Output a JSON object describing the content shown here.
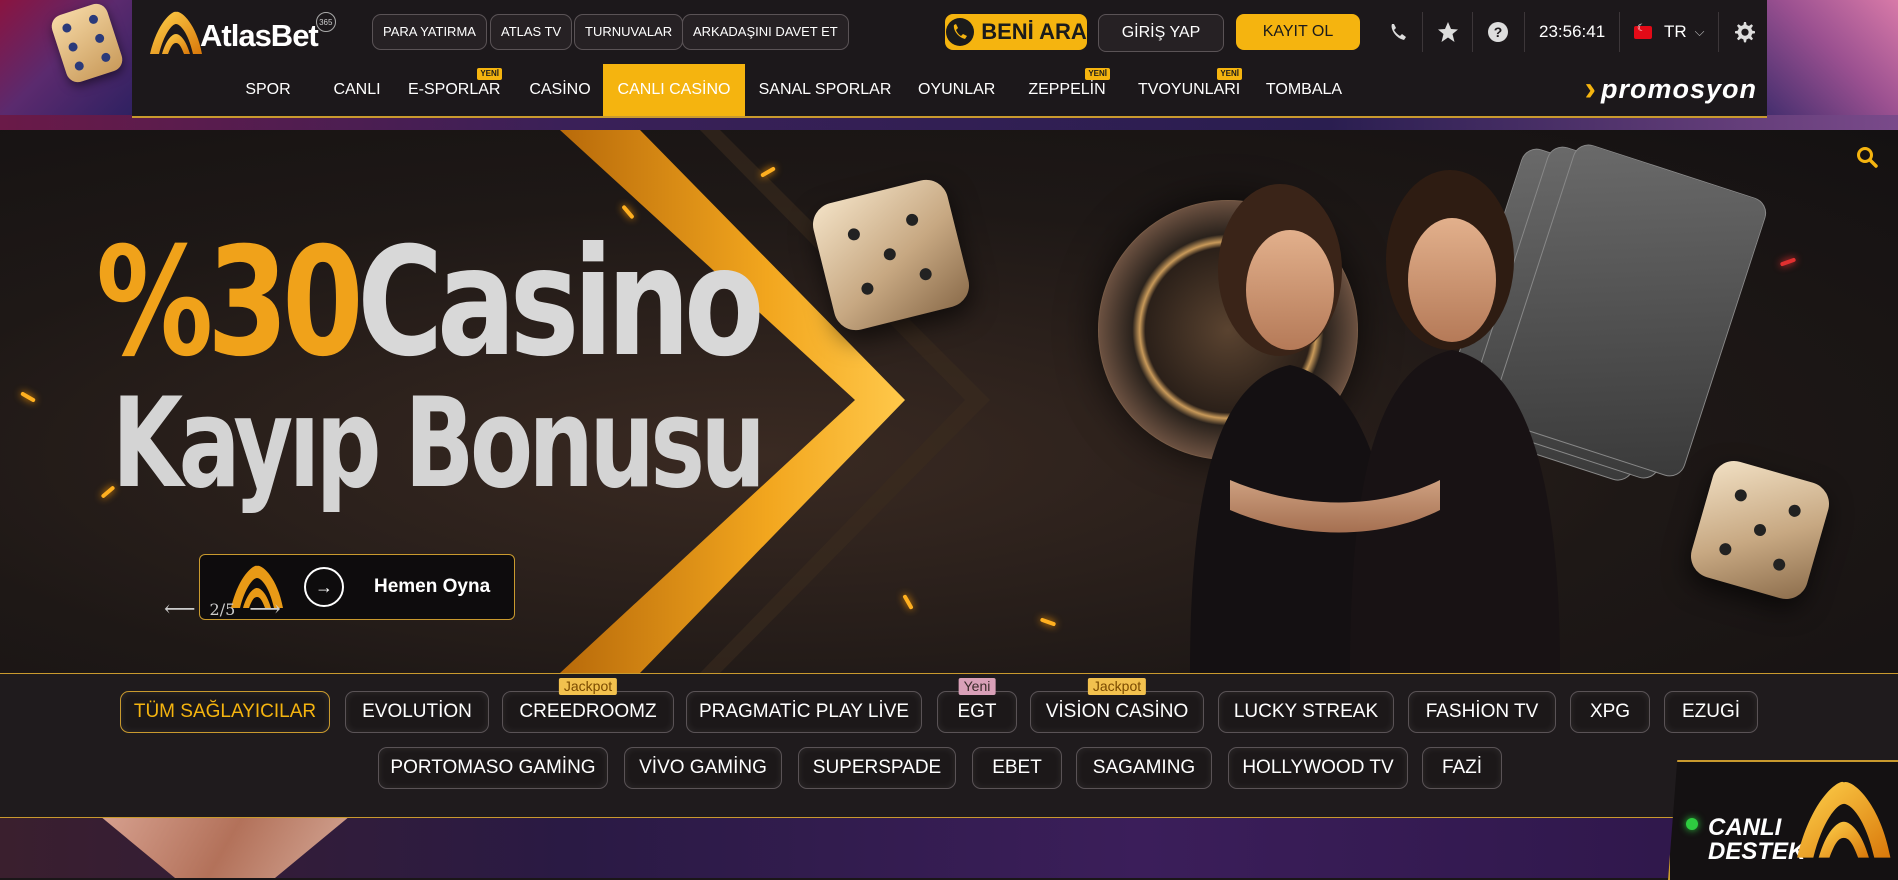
{
  "brand": {
    "name": "AtlasBet",
    "badge": "365",
    "accent": "#f5b40f"
  },
  "top_links": [
    "PARA YATIRMA",
    "ATLAS TV",
    "TURNUVALAR",
    "ARKADAŞINI DAVET ET"
  ],
  "header": {
    "call_me": "BENİ ARA",
    "login": "GİRİŞ YAP",
    "register": "KAYIT OL",
    "time": "23:56:41",
    "language": "TR",
    "icons": [
      "phone-icon",
      "star-icon",
      "help-icon",
      "settings-icon"
    ]
  },
  "nav": {
    "items": [
      {
        "label": "SPOR",
        "badge": ""
      },
      {
        "label": "CANLI",
        "badge": ""
      },
      {
        "label": "E-SPORLAR",
        "badge": "YENİ"
      },
      {
        "label": "CASİNO",
        "badge": ""
      },
      {
        "label": "CANLI CASİNO",
        "badge": "",
        "active": true
      },
      {
        "label": "SANAL SPORLAR",
        "badge": ""
      },
      {
        "label": "OYUNLAR",
        "badge": ""
      },
      {
        "label": "ZEPPELİN",
        "badge": "YENİ"
      },
      {
        "label": "TVOYUNLARI",
        "badge": "YENİ"
      },
      {
        "label": "TOMBALA",
        "badge": ""
      }
    ],
    "promo": "promosyon"
  },
  "hero": {
    "title_percent": "%30",
    "title_word": "Casino",
    "title_line2": "Kayıp Bonusu",
    "cta": "Hemen Oyna",
    "pager": "2/5"
  },
  "providers": {
    "row1": [
      {
        "label": "TÜM SAĞLAYICILAR",
        "active": true,
        "badge": ""
      },
      {
        "label": "EVOLUTİON",
        "badge": ""
      },
      {
        "label": "CREEDROOMZ",
        "badge": "Jackpot"
      },
      {
        "label": "PRAGMATİC PLAY LİVE",
        "badge": ""
      },
      {
        "label": "EGT",
        "badge": "Yeni"
      },
      {
        "label": "VİSİON CASİNO",
        "badge": "Jackpot"
      },
      {
        "label": "LUCKY STREAK",
        "badge": ""
      },
      {
        "label": "FASHİON TV",
        "badge": ""
      },
      {
        "label": "XPG",
        "badge": ""
      },
      {
        "label": "EZUGİ",
        "badge": ""
      }
    ],
    "row2": [
      {
        "label": "PORTOMASO GAMİNG"
      },
      {
        "label": "VİVO GAMİNG"
      },
      {
        "label": "SUPERSPADE"
      },
      {
        "label": "EBET"
      },
      {
        "label": "SAGAMING"
      },
      {
        "label": "HOLLYWOOD TV"
      },
      {
        "label": "FAZİ"
      }
    ]
  },
  "live_support": {
    "line1": "CANLI",
    "line2": "DESTEK"
  }
}
